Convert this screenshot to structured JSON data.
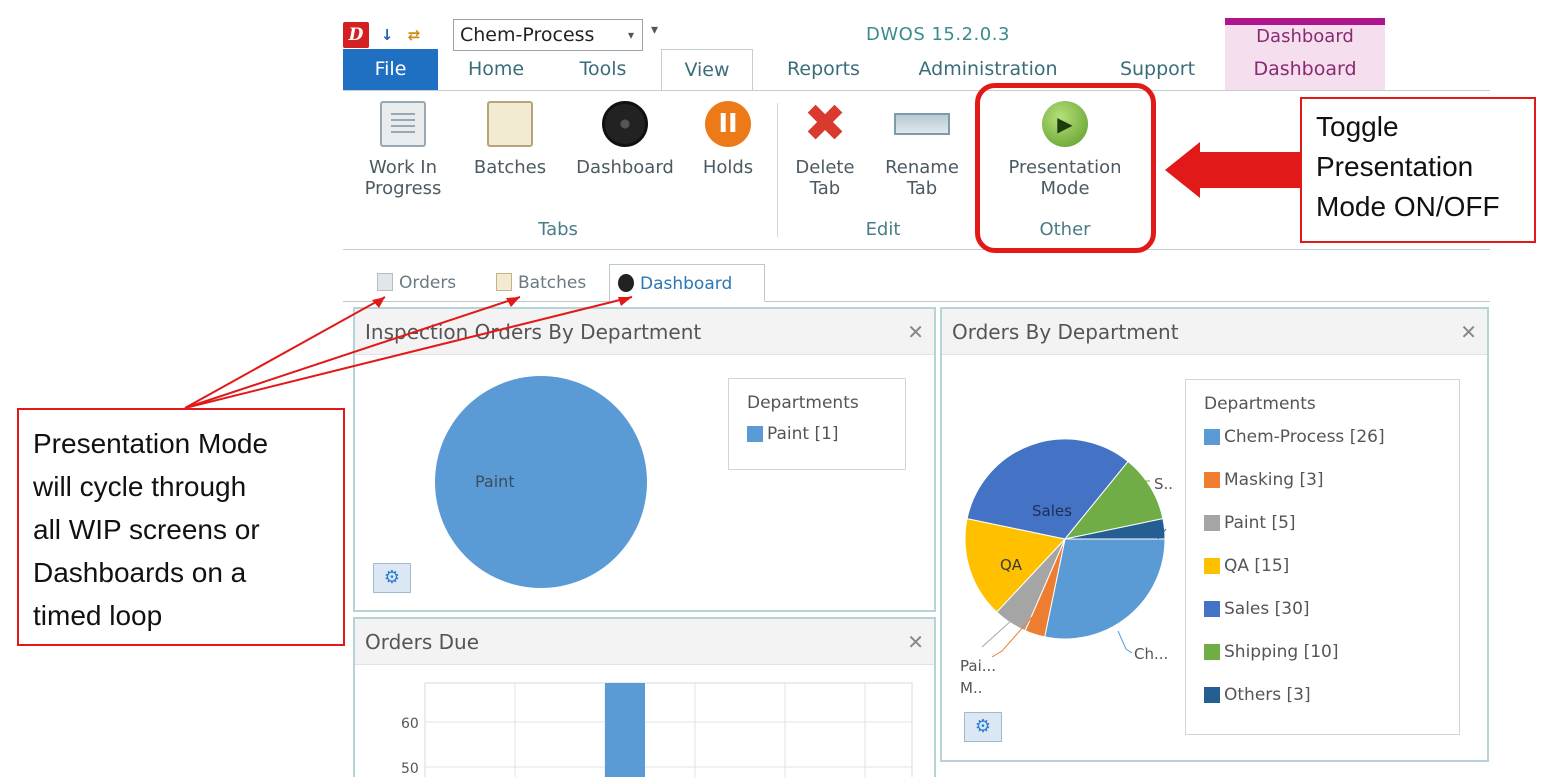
{
  "app": {
    "title": "DWOS 15.2.0.3",
    "process_select": "Chem-Process",
    "contextual_group": "Dashboard"
  },
  "tabs": [
    "File",
    "Home",
    "Tools",
    "View",
    "Reports",
    "Administration",
    "Support",
    "Dashboard"
  ],
  "active_tab": "View",
  "ribbon": {
    "groups": [
      {
        "label": "Tabs",
        "buttons": [
          {
            "label": "Work In\nProgress",
            "icon": "work-in-progress-icon"
          },
          {
            "label": "Batches",
            "icon": "batches-icon"
          },
          {
            "label": "Dashboard",
            "icon": "dashboard-icon"
          },
          {
            "label": "Holds",
            "icon": "holds-pause-icon"
          }
        ]
      },
      {
        "label": "Edit",
        "buttons": [
          {
            "label": "Delete\nTab",
            "icon": "delete-x-icon"
          },
          {
            "label": "Rename\nTab",
            "icon": "rename-icon"
          }
        ]
      },
      {
        "label": "Other",
        "buttons": [
          {
            "label": "Presentation\nMode",
            "icon": "play-icon"
          }
        ]
      }
    ]
  },
  "doc_tabs": [
    "Orders",
    "Batches",
    "Dashboard"
  ],
  "active_doc_tab": "Dashboard",
  "panels": {
    "inspection": {
      "title": "Inspection Orders By Department",
      "legend_title": "Departments",
      "legend": [
        {
          "label": "Paint [1]",
          "color": "#5b9bd5"
        }
      ],
      "slice_label": "Paint"
    },
    "orders_by_dept": {
      "title": "Orders By Department",
      "legend_title": "Departments",
      "legend": [
        {
          "label": "Chem-Process [26]",
          "color": "#5b9bd5"
        },
        {
          "label": "Masking [3]",
          "color": "#ed7d31"
        },
        {
          "label": "Paint [5]",
          "color": "#a5a5a5"
        },
        {
          "label": "QA [15]",
          "color": "#ffc000"
        },
        {
          "label": "Sales  [30]",
          "color": "#4472c4"
        },
        {
          "label": "Shipping [10]",
          "color": "#70ad47"
        },
        {
          "label": "Others [3]",
          "color": "#255e91"
        }
      ],
      "slice_labels": {
        "sales": "Sales",
        "qa": "QA",
        "s": "S..",
        "ch": "Ch...",
        "pai": "Pai...",
        "m": "M.."
      }
    },
    "orders_due": {
      "title": "Orders Due",
      "yticks": [
        "60",
        "50"
      ]
    }
  },
  "chart_data": [
    {
      "type": "pie",
      "title": "Inspection Orders By Department",
      "categories": [
        "Paint"
      ],
      "values": [
        1
      ],
      "legend_title": "Departments"
    },
    {
      "type": "pie",
      "title": "Orders By Department",
      "legend_title": "Departments",
      "categories": [
        "Chem-Process",
        "Masking",
        "Paint",
        "QA",
        "Sales",
        "Shipping",
        "Others"
      ],
      "values": [
        26,
        3,
        5,
        15,
        30,
        10,
        3
      ]
    }
  ],
  "callouts": {
    "right": [
      "Toggle",
      "Presentation",
      "Mode ON/OFF"
    ],
    "left": [
      "Presentation Mode",
      "will cycle through",
      "all WIP screens or",
      "Dashboards on a",
      "timed loop"
    ]
  },
  "colors": {
    "accent_red": "#e21919",
    "file_tab": "#1f6fc2",
    "pie_blue": "#5b9bd5"
  }
}
